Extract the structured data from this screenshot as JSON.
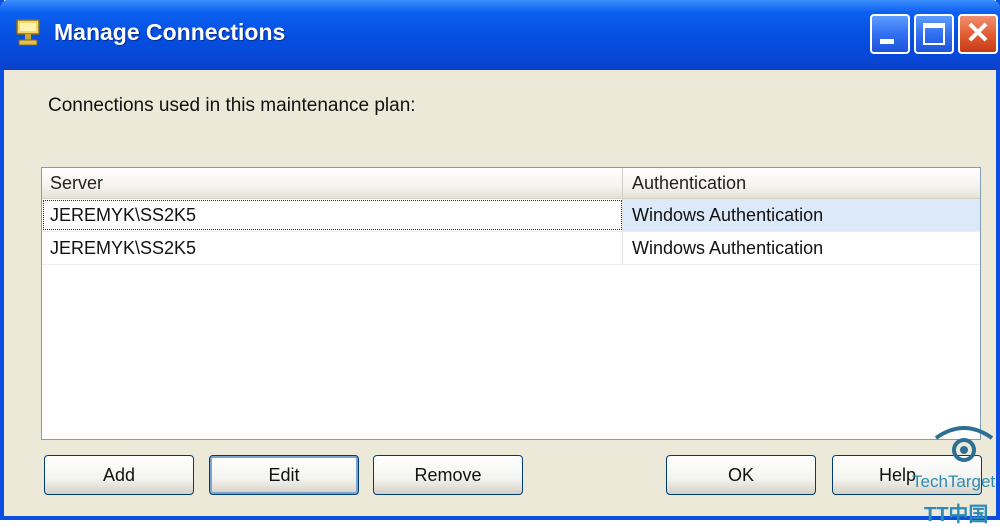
{
  "window": {
    "title": "Manage Connections",
    "colors": {
      "title_bar": "#0550e0",
      "face": "#ece9d8",
      "selection": "#dbe9f9",
      "close_button": "#e05a30"
    }
  },
  "prompt": "Connections used in this maintenance plan:",
  "table": {
    "columns": [
      "Server",
      "Authentication"
    ],
    "rows": [
      {
        "server": "JEREMYK\\SS2K5",
        "authentication": "Windows Authentication",
        "selected": true
      },
      {
        "server": "JEREMYK\\SS2K5",
        "authentication": "Windows Authentication",
        "selected": false
      }
    ]
  },
  "buttons": {
    "add": "Add",
    "edit": "Edit",
    "remove": "Remove",
    "ok": "OK",
    "help": "Help"
  },
  "icons": {
    "app": "maintenance-plan-icon",
    "minimize": "minimize-icon",
    "maximize": "maximize-icon",
    "close": "close-icon"
  },
  "watermark": {
    "brand": "TechTarget",
    "chinese": "TT中国"
  }
}
